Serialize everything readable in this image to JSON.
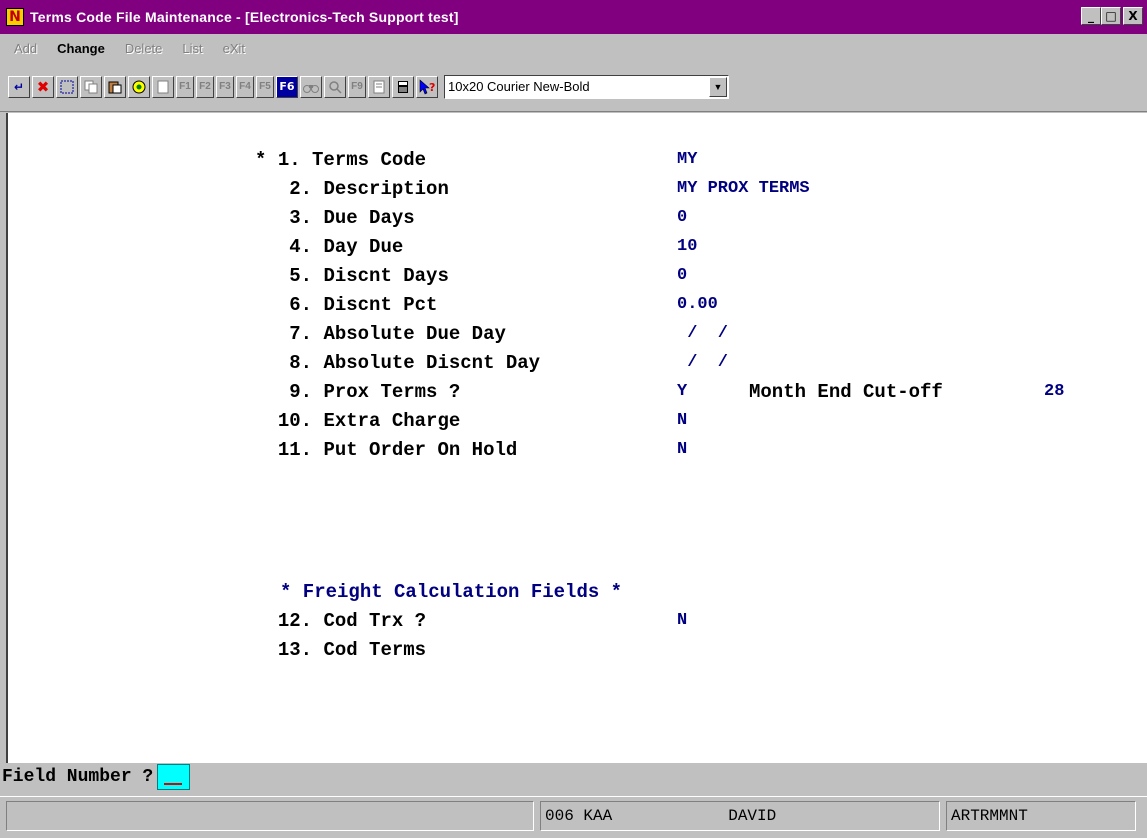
{
  "window": {
    "title": "Terms Code File Maintenance - [Electronics-Tech Support test]",
    "app_icon_letter": "N",
    "minimize": "_",
    "maximize": "□",
    "close": "X"
  },
  "menu": {
    "items": [
      "Add",
      "Change",
      "Delete",
      "List",
      "eXit"
    ],
    "active": "Change"
  },
  "toolbar": {
    "font_selector_value": "10x20 Courier New-Bold",
    "fkeys": [
      "F1",
      "F2",
      "F3",
      "F4",
      "F5",
      "F6",
      "F9"
    ]
  },
  "form": {
    "fields": [
      {
        "marker": "*",
        "number": "1.",
        "label": "Terms Code",
        "value": "MY"
      },
      {
        "marker": "",
        "number": "2.",
        "label": "Description",
        "value": "MY PROX TERMS"
      },
      {
        "marker": "",
        "number": "3.",
        "label": "Due Days",
        "value": "0"
      },
      {
        "marker": "",
        "number": "4.",
        "label": "Day Due",
        "value": "10"
      },
      {
        "marker": "",
        "number": "5.",
        "label": "Discnt Days",
        "value": "0"
      },
      {
        "marker": "",
        "number": "6.",
        "label": "Discnt Pct",
        "value": "0.00"
      },
      {
        "marker": "",
        "number": "7.",
        "label": "Absolute Due Day",
        "value": " /  /"
      },
      {
        "marker": "",
        "number": "8.",
        "label": "Absolute Discnt Day",
        "value": " /  /"
      },
      {
        "marker": "",
        "number": "9.",
        "label": "Prox Terms ?",
        "value": "Y"
      },
      {
        "marker": "",
        "number": "10.",
        "label": "Extra Charge",
        "value": "N"
      },
      {
        "marker": "",
        "number": "11.",
        "label": "Put Order On Hold",
        "value": "N"
      }
    ],
    "month_end_label": "Month End Cut-off",
    "month_end_value": "28",
    "freight_heading": "* Freight Calculation Fields *",
    "freight_fields": [
      {
        "number": "12.",
        "label": "Cod Trx ?",
        "value": "N"
      },
      {
        "number": "13.",
        "label": "Cod Terms",
        "value": ""
      }
    ]
  },
  "prompt": {
    "label": "Field Number ?"
  },
  "status": {
    "cells": [
      "",
      "006 KAA",
      "DAVID",
      "ARTRMMNT"
    ]
  }
}
